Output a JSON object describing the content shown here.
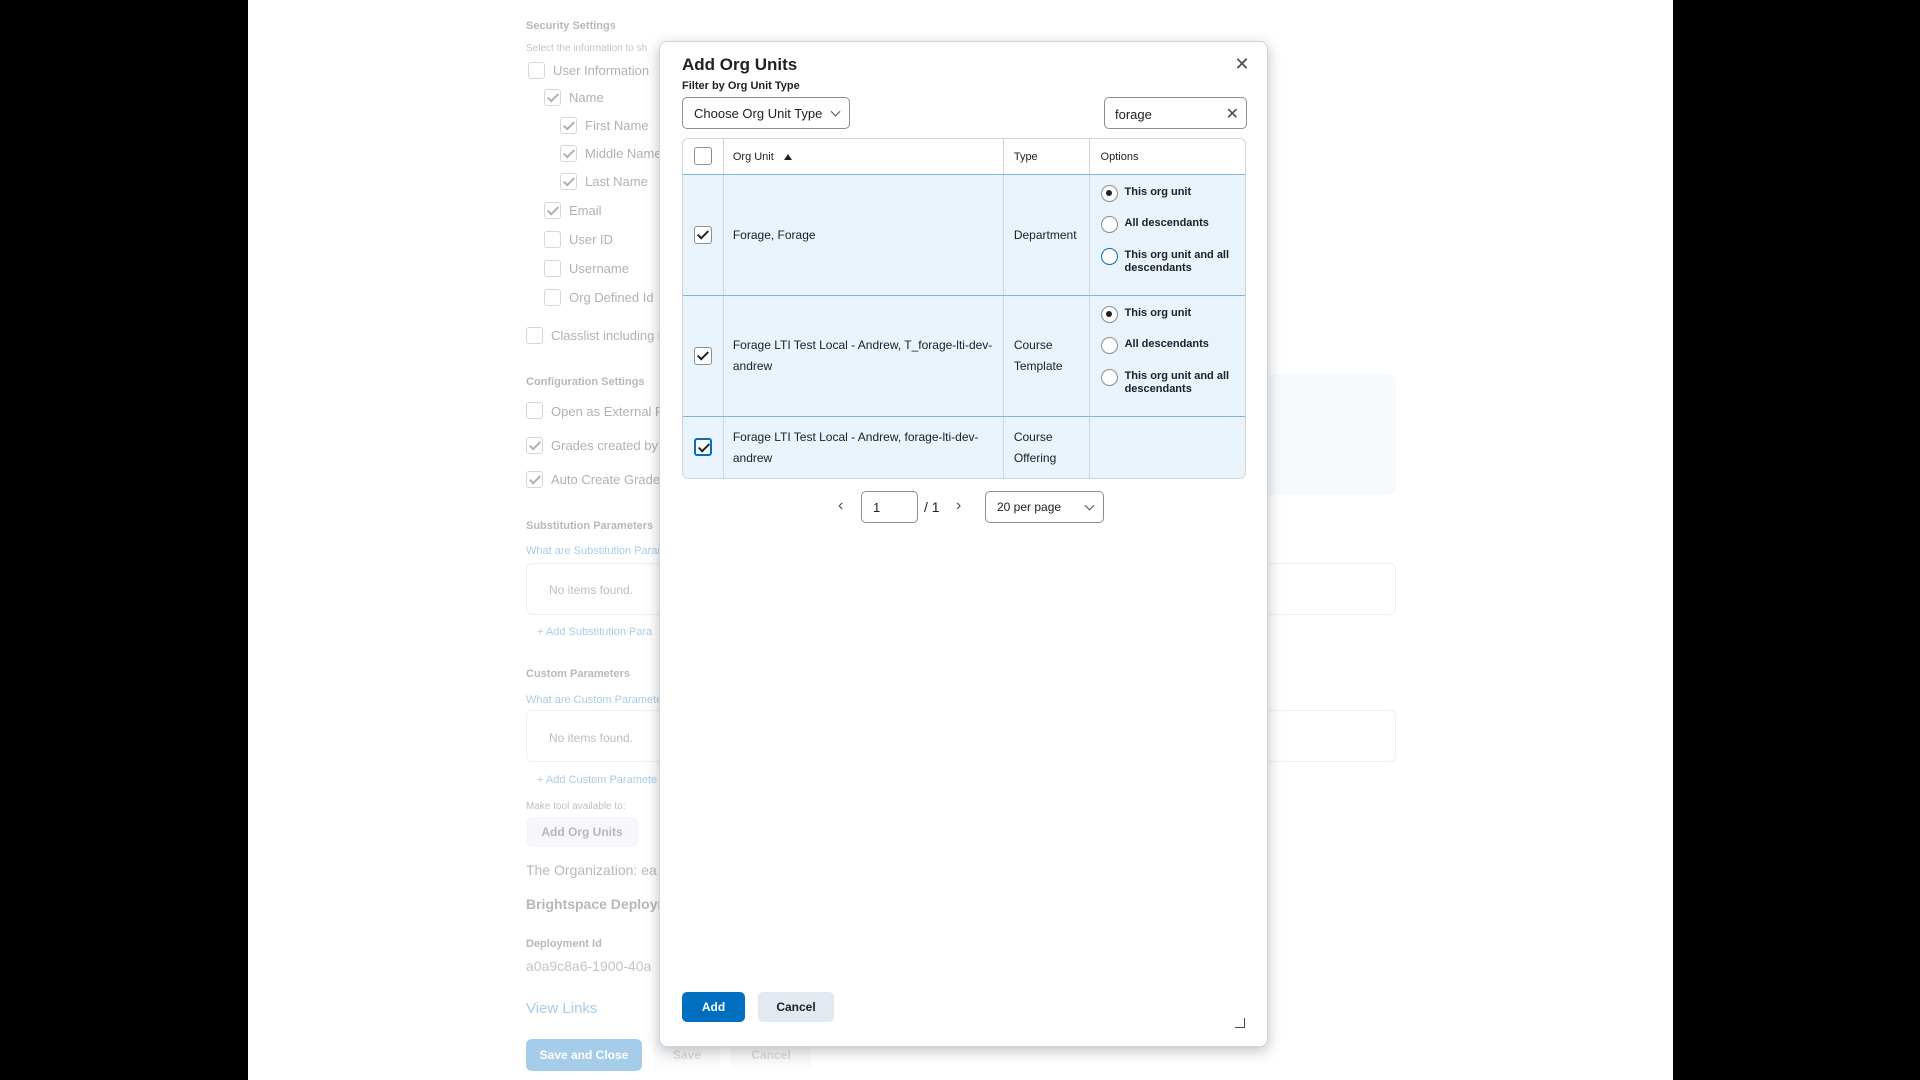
{
  "background": {
    "security_settings": "Security Settings",
    "select_info": "Select the information to sh",
    "checkboxes": [
      {
        "label": "User Information",
        "checked": false
      },
      {
        "label": "Name",
        "checked": true
      },
      {
        "label": "First Name",
        "checked": true
      },
      {
        "label": "Middle Name",
        "checked": true
      },
      {
        "label": "Last Name",
        "checked": true
      },
      {
        "label": "Email",
        "checked": true
      },
      {
        "label": "User ID",
        "checked": false
      },
      {
        "label": "Username",
        "checked": false
      },
      {
        "label": "Org Defined Id",
        "checked": false
      },
      {
        "label": "Classlist including us",
        "checked": false
      }
    ],
    "configuration_settings": "Configuration Settings",
    "config_checkboxes": [
      {
        "label": "Open as External Re",
        "checked": false
      },
      {
        "label": "Grades created by LT",
        "checked": true
      },
      {
        "label": "Auto Create Grade I",
        "checked": true
      }
    ],
    "substitution_parameters": "Substitution Parameters",
    "what_are_substitution": "What are Substitution Param",
    "no_items_1": "No items found.",
    "add_substitution": "Add Substitution Para",
    "custom_parameters": "Custom Parameters",
    "what_are_custom": "What are Custom Parameter",
    "no_items_2": "No items found.",
    "add_custom": "Add Custom Paramete",
    "make_available": "Make tool available to:",
    "add_org_units_btn": "Add Org Units",
    "organization": "The Organization: ea",
    "brightspace_deployment": "Brightspace Deploym",
    "deployment_id_label": "Deployment Id",
    "deployment_id_value": "a0a9c8a6-1900-40a",
    "view_links": "View Links",
    "save_and_close": "Save and Close",
    "save": "Save",
    "cancel": "Cancel"
  },
  "dialog": {
    "title": "Add Org Units",
    "close_icon": "close-icon",
    "filter_label": "Filter by Org Unit Type",
    "filter_select": "Choose Org Unit Type",
    "search_value": "forage",
    "table": {
      "headers": {
        "org_unit": "Org Unit",
        "type": "Type",
        "options": "Options"
      },
      "rows": [
        {
          "org_unit": "Forage, Forage",
          "type": "Department",
          "checked": true,
          "options": [
            "This org unit",
            "All descendants",
            "This org unit and all descendants"
          ],
          "selected_option": 0
        },
        {
          "org_unit": "Forage LTI Test Local - Andrew, T_forage-lti-dev-andrew",
          "type": "Course Template",
          "checked": true,
          "options": [
            "This org unit",
            "All descendants",
            "This org unit and all descendants"
          ],
          "selected_option": 0
        },
        {
          "org_unit": "Forage LTI Test Local - Andrew, forage-lti-dev-andrew",
          "type": "Course Offering",
          "checked": true,
          "options": [],
          "selected_option": null
        }
      ]
    },
    "pager": {
      "page": "1",
      "total": "/ 1",
      "per_page": "20 per page"
    },
    "add_button": "Add",
    "cancel_button": "Cancel"
  }
}
